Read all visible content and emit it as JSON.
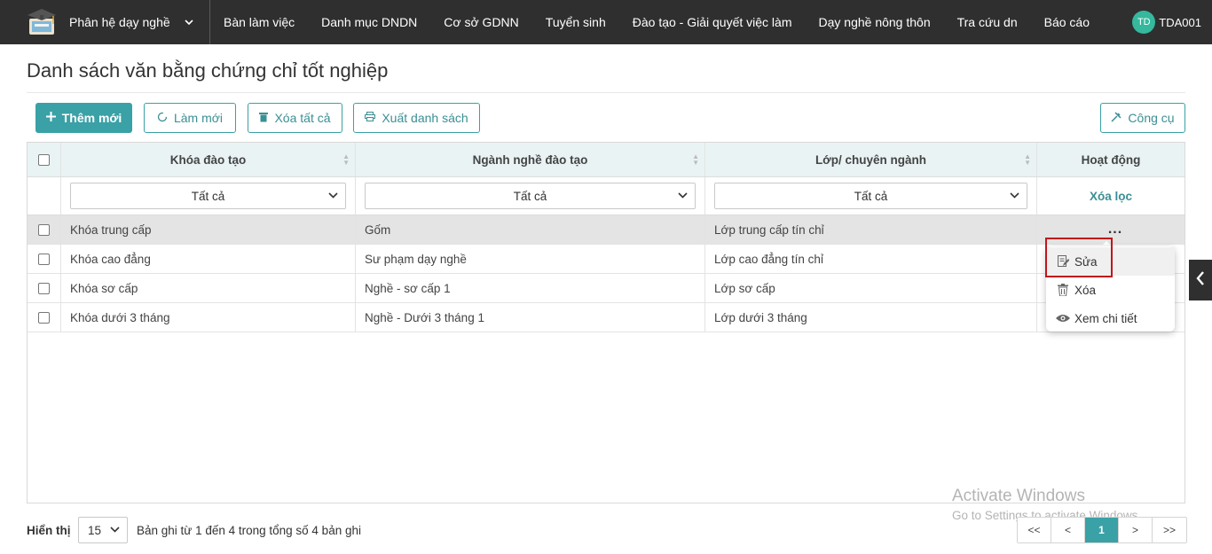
{
  "nav": {
    "module_label": "Phân hệ dạy nghề",
    "items": [
      "Bàn làm việc",
      "Danh mục DNDN",
      "Cơ sở GDNN",
      "Tuyển sinh",
      "Đào tạo - Giải quyết việc làm",
      "Dạy nghề nông thôn",
      "Tra cứu dn",
      "Báo cáo"
    ],
    "user_initials": "TD",
    "user_name": "TDA001"
  },
  "page": {
    "title": "Danh sách văn bằng chứng chỉ tốt nghiệp"
  },
  "toolbar": {
    "add_label": "Thêm mới",
    "refresh_label": "Làm mới",
    "delete_all_label": "Xóa tất cả",
    "export_label": "Xuất danh sách",
    "tools_label": "Công cụ"
  },
  "table": {
    "columns": [
      "Khóa đào tạo",
      "Ngành nghề đào tạo",
      "Lớp/ chuyên ngành",
      "Hoạt động"
    ],
    "filters": [
      "Tất cả",
      "Tất cả",
      "Tất cả"
    ],
    "clear_filter_label": "Xóa lọc",
    "actions_label": "...",
    "rows": [
      [
        "Khóa trung cấp",
        "Gốm",
        "Lớp trung cấp tín chỉ"
      ],
      [
        "Khóa cao đẳng",
        "Sư phạm dạy nghề",
        "Lớp cao đẳng tín chỉ"
      ],
      [
        "Khóa sơ cấp",
        "Nghề - sơ cấp 1",
        "Lớp sơ cấp"
      ],
      [
        "Khóa dưới 3 tháng",
        "Nghề - Dưới 3 tháng 1",
        "Lớp dưới 3 tháng"
      ]
    ]
  },
  "action_menu": {
    "edit_label": "Sửa",
    "delete_label": "Xóa",
    "view_label": "Xem chi tiết"
  },
  "footer": {
    "show_label": "Hiển thị",
    "page_size": "15",
    "summary": "Bản ghi từ 1 đến 4 trong tổng số 4 bản ghi",
    "pager": [
      "<<",
      "<",
      "1",
      ">",
      ">>"
    ]
  },
  "watermark": {
    "line1": "Activate Windows",
    "line2": "Go to Settings to activate Windows."
  },
  "colors": {
    "accent": "#3aa1a6",
    "topbar": "#2f2f2f",
    "highlight": "#c0161c"
  }
}
